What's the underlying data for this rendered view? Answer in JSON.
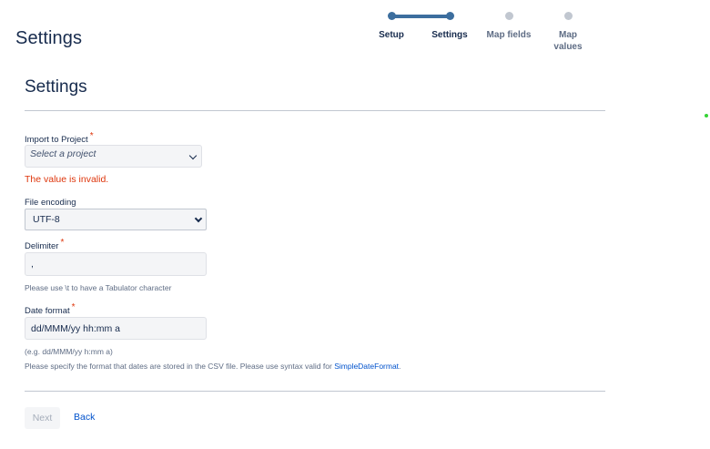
{
  "page": {
    "title": "Settings"
  },
  "tracker": {
    "steps": [
      {
        "label": "Setup",
        "state": "done"
      },
      {
        "label": "Settings",
        "state": "current"
      },
      {
        "label": "Map fields",
        "state": "todo"
      },
      {
        "label": "Map values",
        "state": "todo"
      }
    ]
  },
  "section": {
    "title": "Settings"
  },
  "form": {
    "project": {
      "label": "Import to Project",
      "required_mark": "*",
      "placeholder": "Select a project",
      "error": "The value is invalid."
    },
    "encoding": {
      "label": "File encoding",
      "value": "UTF-8"
    },
    "delimiter": {
      "label": "Delimiter",
      "required_mark": "*",
      "value": ",",
      "help": "Please use \\t to have a Tabulator character"
    },
    "date_format": {
      "label": "Date format",
      "required_mark": "*",
      "value": "dd/MMM/yy hh:mm a",
      "example": "(e.g. dd/MMM/yy h:mm a)",
      "help_prefix": "Please specify the format that dates are stored in the CSV file. Please use syntax valid for ",
      "help_link": "SimpleDateFormat",
      "help_suffix": "."
    }
  },
  "actions": {
    "next_label": "Next",
    "back_label": "Back"
  },
  "colors": {
    "accent": "#3c6e9e",
    "link": "#0052cc",
    "error": "#de350b"
  }
}
